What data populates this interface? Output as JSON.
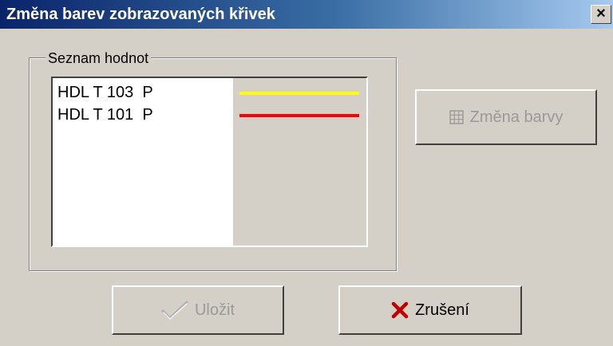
{
  "window": {
    "title": "Změna barev zobrazovaných křivek",
    "close_label": "×"
  },
  "group": {
    "label": "Seznam hodnot"
  },
  "list": {
    "items": [
      {
        "label": "HDL T 103  P",
        "color": "#ffff00"
      },
      {
        "label": "HDL T 101  P",
        "color": "#ff0000"
      }
    ]
  },
  "buttons": {
    "change_color": {
      "label": "Změna barvy",
      "icon": "grid-icon",
      "enabled": false
    },
    "save": {
      "label": "Uložit",
      "icon": "checkmark-icon",
      "enabled": false
    },
    "cancel": {
      "label": "Zrušení",
      "icon": "red-x-icon",
      "enabled": true
    }
  }
}
